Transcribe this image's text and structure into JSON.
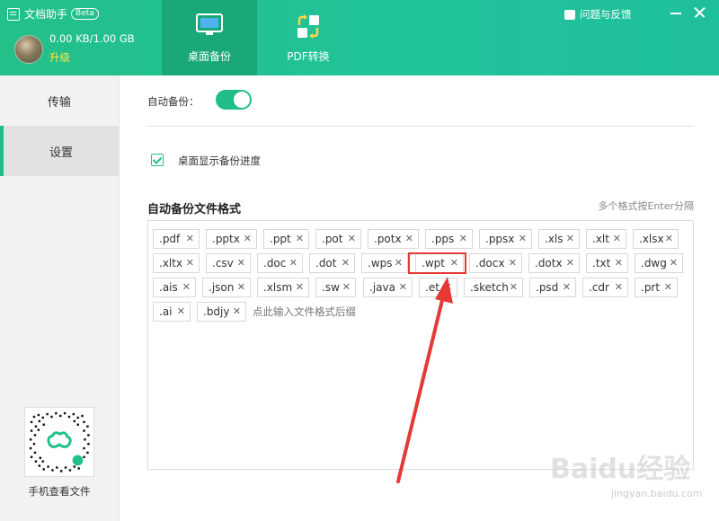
{
  "app": {
    "title": "文档助手",
    "beta": "Beta"
  },
  "account": {
    "storage": "0.00 KB/1.00 GB",
    "upgrade": "升级"
  },
  "nav": {
    "desktop_backup": "桌面备份",
    "pdf_convert": "PDF转换"
  },
  "header": {
    "feedback": "问题与反馈"
  },
  "sidebar": {
    "transfer": "传输",
    "settings": "设置",
    "qr_caption": "手机查看文件"
  },
  "settings": {
    "auto_backup_label": "自动备份：",
    "auto_backup_on": true,
    "show_progress_label": "桌面显示备份进度",
    "show_progress_checked": true,
    "formats_title": "自动备份文件格式",
    "formats_hint": "多个格式按Enter分隔",
    "input_placeholder": "点此输入文件格式后缀",
    "highlighted_format": ".wpt",
    "formats": [
      ".pdf",
      ".pptx",
      ".ppt",
      ".pot",
      ".potx",
      ".pps",
      ".ppsx",
      ".xls",
      ".xlt",
      ".xlsx",
      ".xltx",
      ".csv",
      ".doc",
      ".dot",
      ".wps",
      ".wpt",
      ".docx",
      ".dotx",
      ".txt",
      ".dwg",
      ".ais",
      ".json",
      ".xlsm",
      ".sw",
      ".java",
      ".et",
      ".sketch",
      ".psd",
      ".cdr",
      ".prt",
      ".ai",
      ".bdjy"
    ]
  },
  "watermark": {
    "brand": "Baidu经验",
    "url": "jingyan.baidu.com"
  },
  "colors": {
    "accent": "#20bd8a",
    "highlight": "#e53935"
  }
}
